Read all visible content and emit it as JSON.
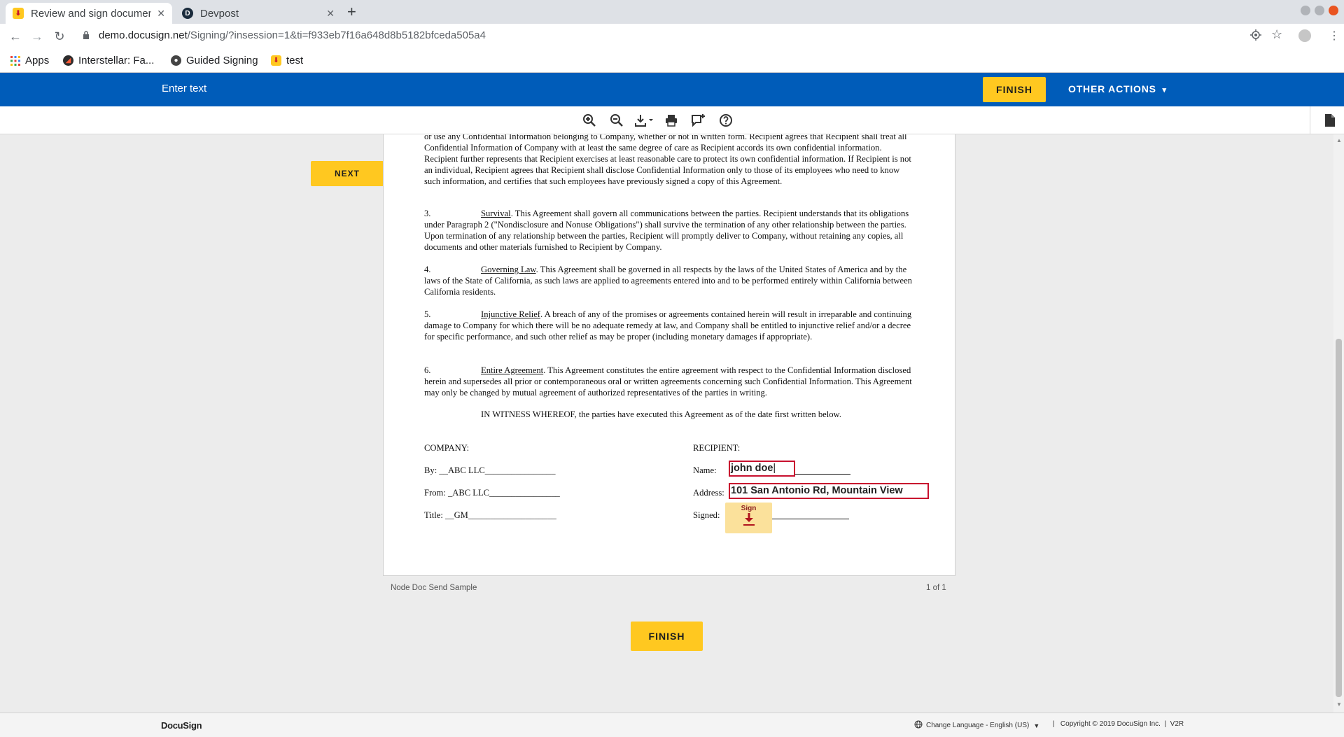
{
  "browser": {
    "tabs": [
      {
        "title": "Review and sign documen",
        "active": true,
        "icon": "docusign-download-icon"
      },
      {
        "title": "Devpost",
        "active": false,
        "icon": "devpost-icon",
        "icon_letter": "D"
      }
    ],
    "new_tab": "+",
    "url_host": "demo.docusign.net",
    "url_path": "/Signing/?insession=1&ti=f933eb7f16a648d8b5182bfceda505a4",
    "bookmarks": [
      "Apps",
      "Interstellar: Fa...",
      "Guided Signing",
      "test"
    ]
  },
  "header": {
    "instruction": "Enter text",
    "finish_label": "FINISH",
    "other_actions_label": "OTHER ACTIONS",
    "other_actions_caret": "▾"
  },
  "toolbar": {
    "tools": [
      "zoom-in-icon",
      "zoom-out-icon",
      "download-icon",
      "print-icon",
      "add-comment-icon",
      "help-icon"
    ]
  },
  "document": {
    "para2_tail": "or use any Confidential Information belonging to Company, whether or not in written form.  Recipient agrees that Recipient shall treat all Confidential Information of Company with at least the same degree of care as Recipient accords its own confidential information.  Recipient further represents that Recipient exercises at least reasonable care to protect its own confidential information.  If Recipient is not an individual, Recipient agrees that Recipient shall disclose Confidential Information only to those of its employees who need to know such information, and certifies that such employees have previously signed a copy of this Agreement.",
    "sections": [
      {
        "num": "3.",
        "heading": "Survival",
        "text": ".  This Agreement shall govern all communications between the parties.  Recipient understands that its obligations under Paragraph 2 (\"Nondisclosure and Nonuse Obligations\") shall survive the termination of any other relationship between the parties.  Upon termination of any relationship between the parties, Recipient will promptly deliver to Company, without retaining any copies, all documents and other materials furnished to Recipient by Company."
      },
      {
        "num": "4.",
        "heading": "Governing Law",
        "text": ".  This Agreement shall be governed in all respects by the laws of the United States of America and by the laws of the State of California, as such laws are applied to agreements entered into and to be performed entirely within California between California residents."
      },
      {
        "num": "5.",
        "heading": "Injunctive Relief",
        "text": ".  A breach of any of the promises or agreements contained herein will result in irreparable and continuing damage to Company for which there will be no adequate remedy at law, and Company shall be entitled to injunctive relief and/or a decree for specific performance, and such other relief as may be proper (including monetary damages if appropriate)."
      },
      {
        "num": "6.",
        "heading": "Entire Agreement",
        "text": ".  This Agreement constitutes the entire agreement with respect to the Confidential Information disclosed herein and supersedes all prior or contemporaneous oral or written agreements concerning such Confidential Information.  This Agreement may only be changed by mutual agreement of authorized representatives of the parties in writing."
      }
    ],
    "witness": "IN WITNESS WHEREOF, the parties have executed this Agreement as of the date first written below.",
    "company": {
      "heading": "COMPANY:",
      "by": "By:  __ABC LLC________________",
      "from": "From: _ABC LLC________________",
      "title": "Title: __GM____________________"
    },
    "recipient": {
      "heading": "RECIPIENT:",
      "name_label": "Name:",
      "address_label": "Address:",
      "signed_label": "Signed:",
      "name_value": "john doe",
      "address_value": "101 San Antonio Rd, Mountain View",
      "sign_tag": "Sign"
    },
    "footer_left": "Node Doc Send Sample",
    "footer_right": "1 of 1"
  },
  "next_label": "NEXT",
  "bottom_finish_label": "FINISH",
  "footer": {
    "brand": "DocuSign",
    "language": "Change Language - English (US)",
    "language_caret": "▼",
    "copyright": "|   Copyright © 2019 DocuSign Inc.  |  V2R"
  },
  "colors": {
    "brand_blue": "#005cb9",
    "accent_yellow": "#ffc820",
    "field_red": "#c8102e"
  }
}
